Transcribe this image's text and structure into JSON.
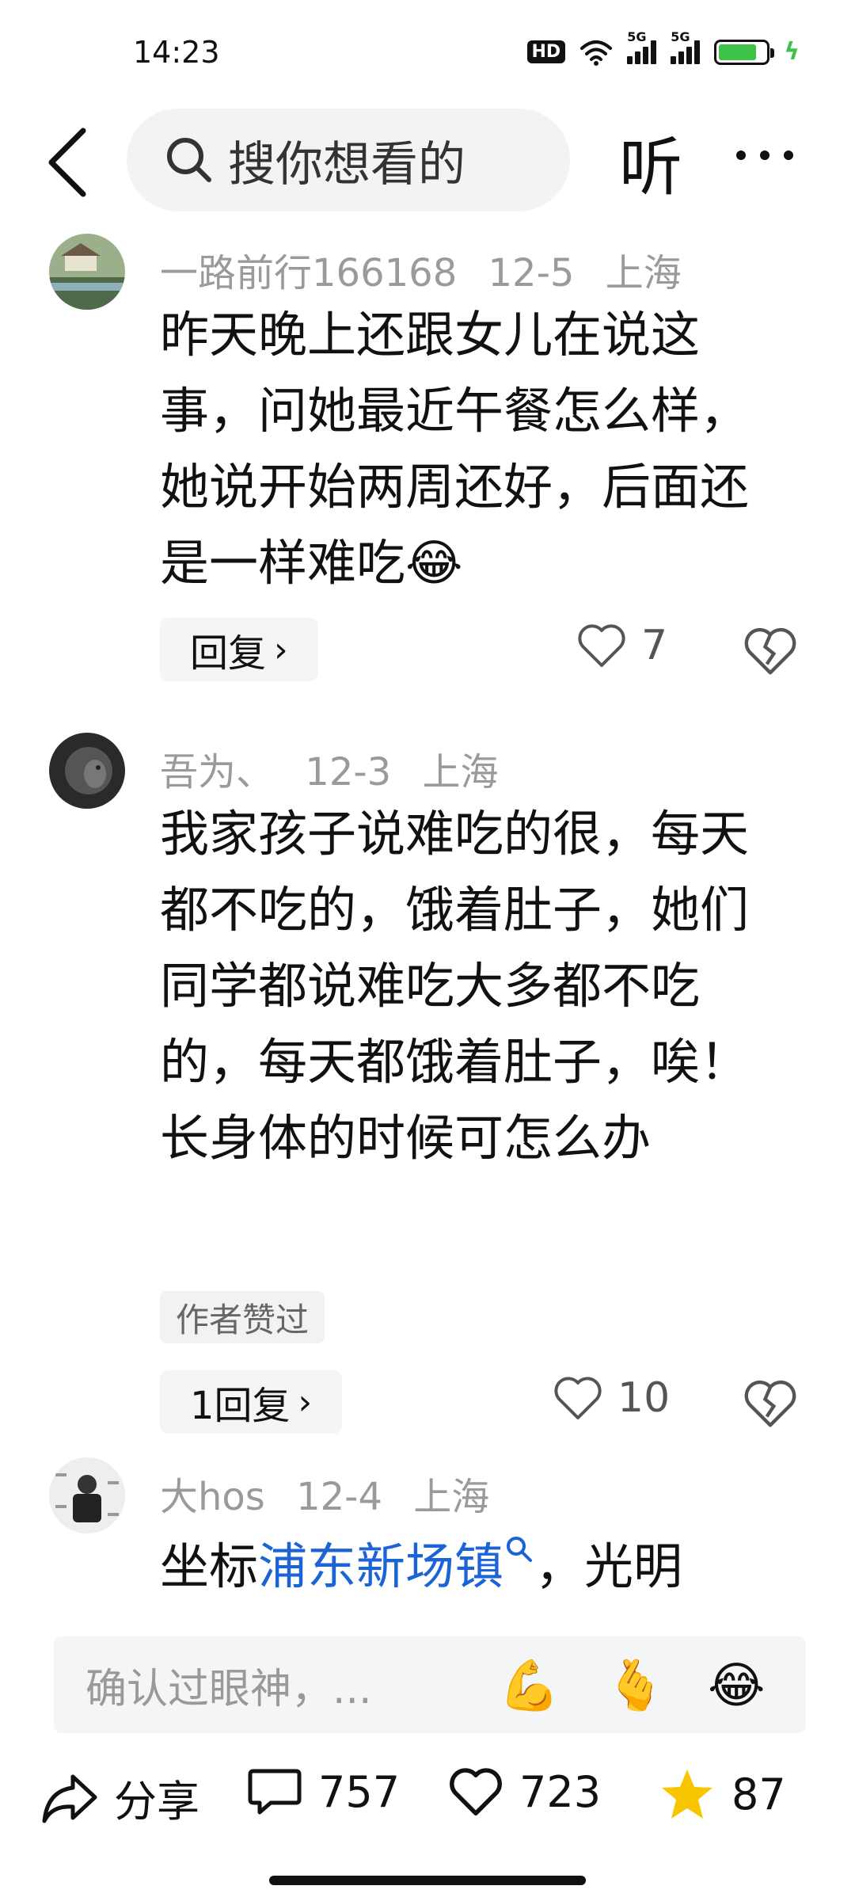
{
  "status": {
    "time": "14:23",
    "hd": "HD",
    "net1": "5G",
    "net2": "5G"
  },
  "nav": {
    "search_placeholder": "搜你想看的",
    "listen": "听"
  },
  "comments": [
    {
      "user": "一路前行166168",
      "date": "12-5",
      "location": "上海",
      "text": "昨天晚上还跟女儿在说这事，问她最近午餐怎么样，她说开始两周还好，后面还是一样难吃😂",
      "reply_label": "回复",
      "likes": "7"
    },
    {
      "user": "吾为、",
      "date": "12-3",
      "location": "上海",
      "text": "我家孩子说难吃的很，每天都不吃的，饿着肚子，她们同学都说难吃大多都不吃的，每天都饿着肚子，唉！长身体的时候可怎么办",
      "badge": "作者赞过",
      "reply_label": "1回复",
      "likes": "10"
    },
    {
      "user": "大hos",
      "date": "12-4",
      "location": "上海",
      "text_prefix": "坐标",
      "text_link": "浦东新场镇",
      "text_suffix": "，光明"
    }
  ],
  "input": {
    "placeholder": "确认过眼神，...",
    "emojis": [
      "💪",
      "🫰",
      "😂"
    ]
  },
  "actions": {
    "share_label": "分享",
    "comments_count": "757",
    "likes_count": "723",
    "favorites_count": "87"
  },
  "colors": {
    "link": "#1c63d6",
    "star": "#f7c600",
    "battery": "#3fc24a"
  }
}
